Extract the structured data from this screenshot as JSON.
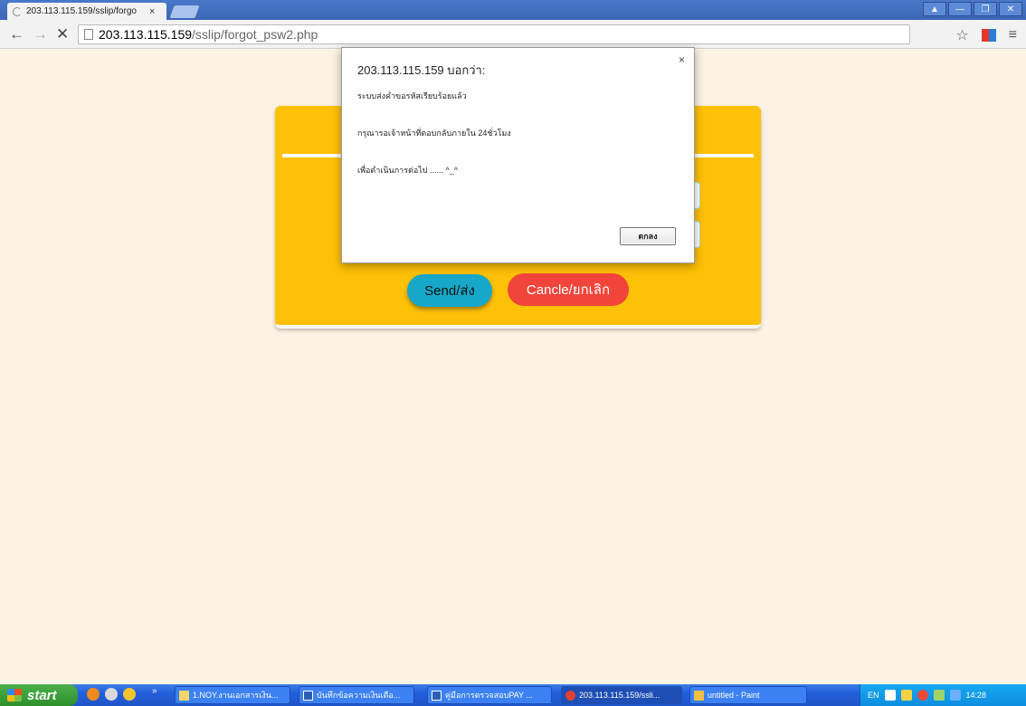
{
  "browser": {
    "tab_title": "203.113.115.159/sslip/forgo",
    "tab_close": "×",
    "url_host": "203.113.115.159",
    "url_path": "/sslip/forgot_psw2.php",
    "window_buttons": [
      "▲",
      "—",
      "❐",
      "✕"
    ]
  },
  "page": {
    "send_label": "Send/ส่ง",
    "cancel_label": "Cancle/ยกเลิก"
  },
  "dialog": {
    "title": "203.113.115.159 บอกว่า:",
    "close": "×",
    "lines": [
      "ระบบส่งคำขอรหัสเรียบร้อยแล้ว",
      "กรุณารอเจ้าหน้าที่ตอบกลับภายใน 24ชั่วโมง",
      "เพื่อดำเนินการต่อไป ...... ^_^"
    ],
    "ok_label": "ตกลง"
  },
  "taskbar": {
    "start_label": "start",
    "tasks": [
      "1.NOY.งานเอกสารเงิน...",
      "บันทึกข้อความเงินเดือ...",
      "คู่มือการตรวจสอบPAY ...",
      "203.113.115.159/ssli...",
      "untitled - Paint"
    ],
    "lang": "EN",
    "time": "14:28"
  },
  "colors": {
    "card": "#ffc107",
    "send": "#17a8c9",
    "cancel": "#f1453b",
    "page_bg": "#fdf3e4"
  }
}
